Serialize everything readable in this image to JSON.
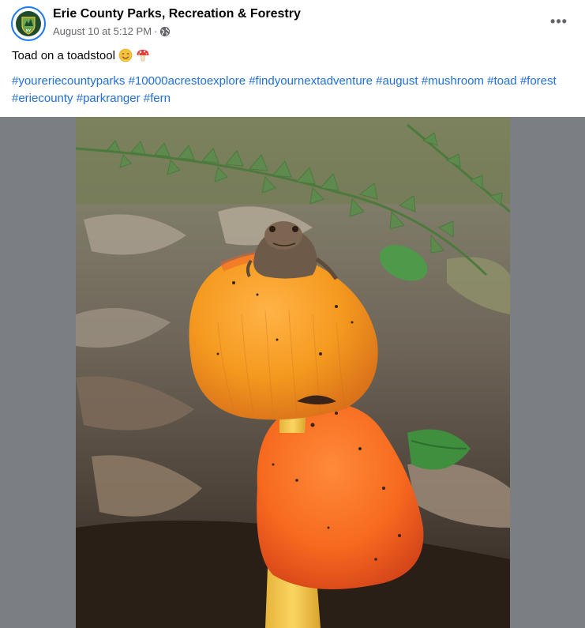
{
  "post": {
    "page_name": "Erie County Parks, Recreation & Forestry",
    "timestamp": "August 10 at 5:12 PM",
    "separator": "·",
    "privacy_icon": "globe-icon",
    "more_icon": "more-options-icon",
    "more_label": "•••",
    "text": "Toad on a toadstool",
    "emojis": [
      "smiling-face-emoji",
      "mushroom-emoji"
    ],
    "hashtags": [
      "#youreriecountyparks",
      "#10000acrestoexplore",
      "#findyournextadventure",
      "#august",
      "#mushroom",
      "#toad",
      "#forest",
      "#eriecounty",
      "#parkranger",
      "#fern"
    ]
  },
  "avatar": {
    "icon": "erie-county-parks-logo",
    "badge_text": "NY"
  },
  "photo": {
    "subject": "toad-on-mushroom-photo"
  },
  "colors": {
    "accent": "#1877f2",
    "link": "#216fdb",
    "secondary_text": "#65676b",
    "media_backdrop": "#7b7e82"
  }
}
